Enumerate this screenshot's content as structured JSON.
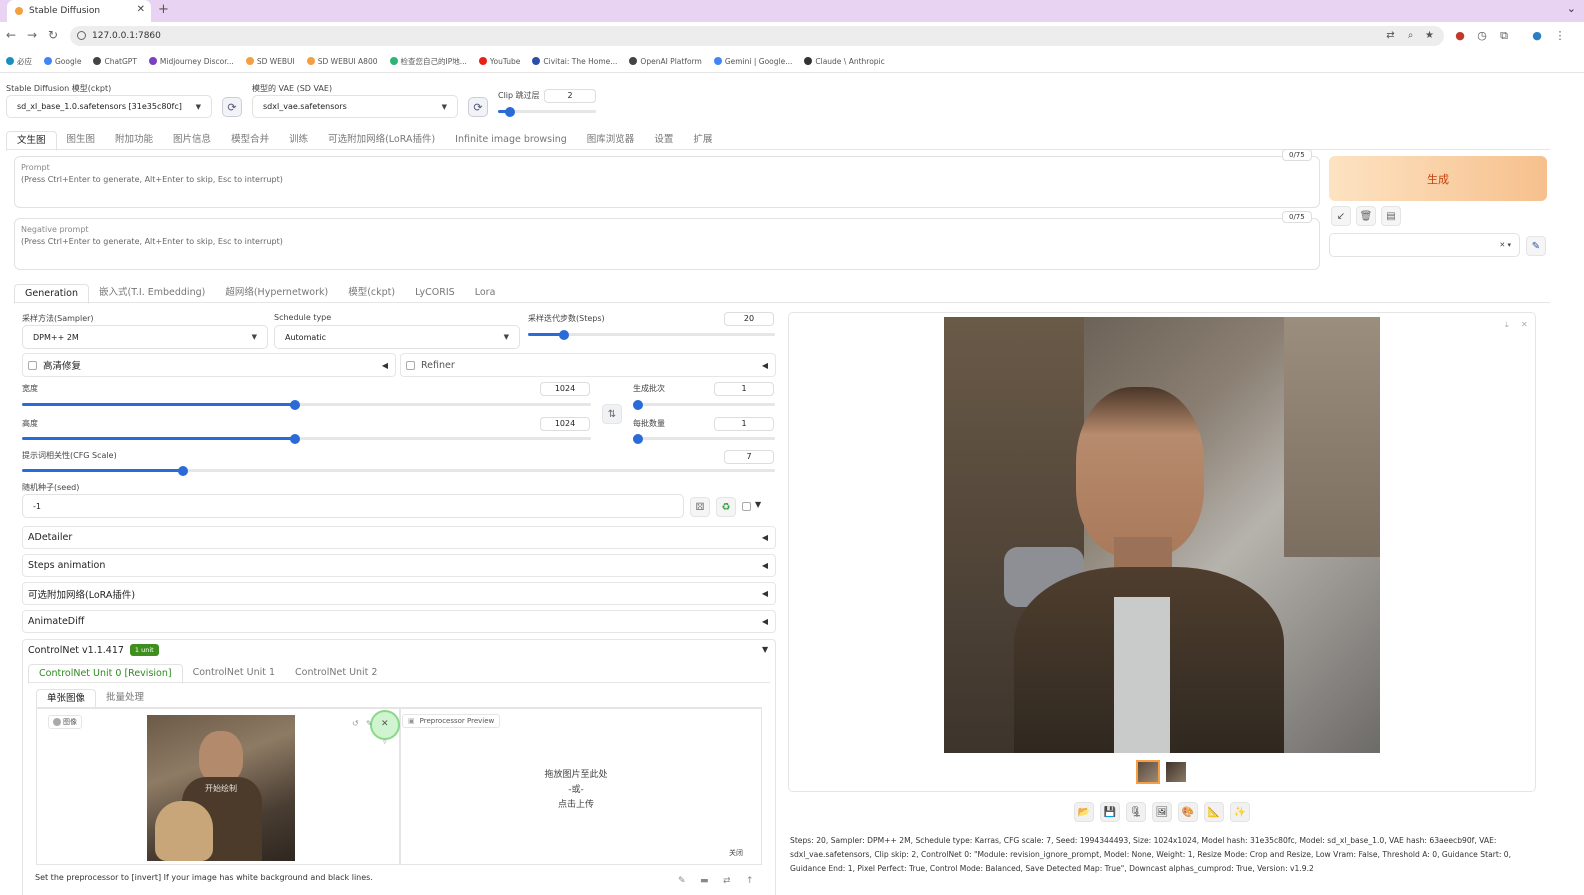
{
  "browser": {
    "tab_title": "Stable Diffusion",
    "url": "127.0.0.1:7860",
    "bookmarks": [
      {
        "label": "必应",
        "color": "#1a8fbf"
      },
      {
        "label": "Google",
        "color": "#4285f4"
      },
      {
        "label": "ChatGPT",
        "color": "#444444"
      },
      {
        "label": "Midjourney Discor...",
        "color": "#7a3fc2"
      },
      {
        "label": "SD WEBUI",
        "color": "#f59e42"
      },
      {
        "label": "SD WEBUI A800",
        "color": "#f59e42"
      },
      {
        "label": "检查您自己的IP地...",
        "color": "#2bb673"
      },
      {
        "label": "YouTube",
        "color": "#e62117"
      },
      {
        "label": "Civitai: The Home...",
        "color": "#2b4ea8"
      },
      {
        "label": "OpenAI Platform",
        "color": "#444444"
      },
      {
        "label": "Gemini | Google...",
        "color": "#4285f4"
      },
      {
        "label": "Claude \\ Anthropic",
        "color": "#333333"
      }
    ]
  },
  "top": {
    "ckpt_label": "Stable Diffusion 模型(ckpt)",
    "ckpt_value": "sd_xl_base_1.0.safetensors [31e35c80fc]",
    "vae_label": "模型的 VAE (SD VAE)",
    "vae_value": "sdxl_vae.safetensors",
    "clip_label": "Clip 跳过层",
    "clip_value": "2",
    "clip_fraction": 0.08
  },
  "main_tabs": [
    "文生图",
    "图生图",
    "附加功能",
    "图片信息",
    "模型合并",
    "训练",
    "可选附加网络(LoRA插件)",
    "Infinite image browsing",
    "图库浏览器",
    "设置",
    "扩展"
  ],
  "prompt": {
    "label": "Prompt",
    "hint": "(Press Ctrl+Enter to generate, Alt+Enter to skip, Esc to interrupt)",
    "counter": "0/75"
  },
  "negative_prompt": {
    "label": "Negative prompt",
    "hint": "(Press Ctrl+Enter to generate, Alt+Enter to skip, Esc to interrupt)",
    "counter": "0/75"
  },
  "generate_label": "生成",
  "sub_tabs": [
    "Generation",
    "嵌入式(T.I. Embedding)",
    "超网络(Hypernetwork)",
    "模型(ckpt)",
    "LyCORIS",
    "Lora"
  ],
  "gen": {
    "sampler_label": "采样方法(Sampler)",
    "sampler_value": "DPM++ 2M",
    "schedule_label": "Schedule type",
    "schedule_value": "Automatic",
    "steps_label": "采样迭代步数(Steps)",
    "steps_value": "20",
    "steps_fraction": 0.13,
    "hires_label": "高清修复",
    "refiner_label": "Refiner",
    "width_label": "宽度",
    "width_value": "1024",
    "width_fraction": 0.48,
    "height_label": "高度",
    "height_value": "1024",
    "height_fraction": 0.48,
    "batch_count_label": "生成批次",
    "batch_count_value": "1",
    "batch_count_fraction": 0.0,
    "batch_size_label": "每批数量",
    "batch_size_value": "1",
    "batch_size_fraction": 0.0,
    "cfg_label": "提示词相关性(CFG Scale)",
    "cfg_value": "7",
    "cfg_fraction": 0.21,
    "seed_label": "随机种子(seed)",
    "seed_value": "-1"
  },
  "accordions": [
    "ADetailer",
    "Steps animation",
    "可选附加网络(LoRA插件)",
    "AnimateDiff"
  ],
  "controlnet": {
    "title": "ControlNet v1.1.417",
    "badge": "1 unit",
    "unit_tabs": [
      "ControlNet Unit 0 [Revision]",
      "ControlNet Unit 1",
      "ControlNet Unit 2"
    ],
    "image_tabs": [
      "单张图像",
      "批量处理"
    ],
    "image_label": "图像",
    "image_overlay": "开始绘制",
    "preview_label": "Preprocessor Preview",
    "drop_line1": "拖放图片至此处",
    "drop_line2": "-或-",
    "drop_line3": "点击上传",
    "close_label": "关闭",
    "hint": "Set the preprocessor to [invert] If your image has white background and black lines."
  },
  "output": {
    "info": "Steps: 20, Sampler: DPM++ 2M, Schedule type: Karras, CFG scale: 7, Seed: 1994344493, Size: 1024x1024, Model hash: 31e35c80fc, Model: sd_xl_base_1.0, VAE hash: 63aeecb90f, VAE: sdxl_vae.safetensors, Clip skip: 2, ControlNet 0: \"Module: revision_ignore_prompt, Model: None, Weight: 1, Resize Mode: Crop and Resize, Low Vram: False, Threshold A: 0, Guidance Start: 0, Guidance End: 1, Pixel Perfect: True, Control Mode: Balanced, Save Detected Map: True\", Downcast alphas_cumprod: True, Version: v1.9.2"
  }
}
